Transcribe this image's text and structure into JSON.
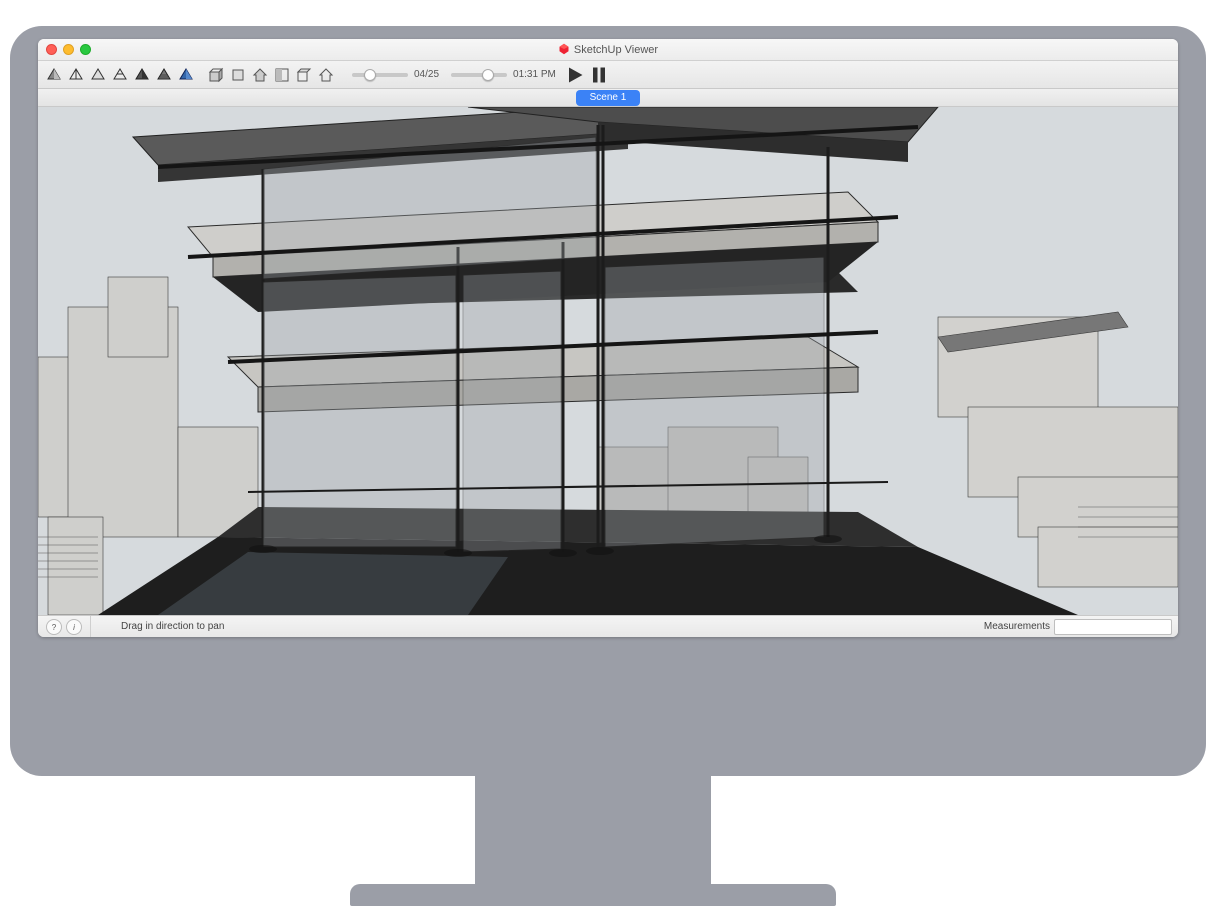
{
  "window": {
    "title": "SketchUp Viewer"
  },
  "toolbar": {
    "style_icons": [
      "style-shaded",
      "style-hidden-line",
      "style-monochrome",
      "style-wireframe",
      "style-xray",
      "style-textured",
      "style-back-edges"
    ],
    "view_icons": [
      "view-iso",
      "view-top",
      "view-front",
      "view-perspective",
      "view-section",
      "view-home"
    ],
    "date_slider": {
      "label": "04/25",
      "pos": 0.25
    },
    "time_slider": {
      "label": "01:31 PM",
      "pos": 0.55
    },
    "play_label": "Play",
    "pause_label": "Pause"
  },
  "scene": {
    "active_tab": "Scene 1"
  },
  "statusbar": {
    "hint": "Drag in direction to pan",
    "measurements_label": "Measurements",
    "measurements_value": ""
  }
}
